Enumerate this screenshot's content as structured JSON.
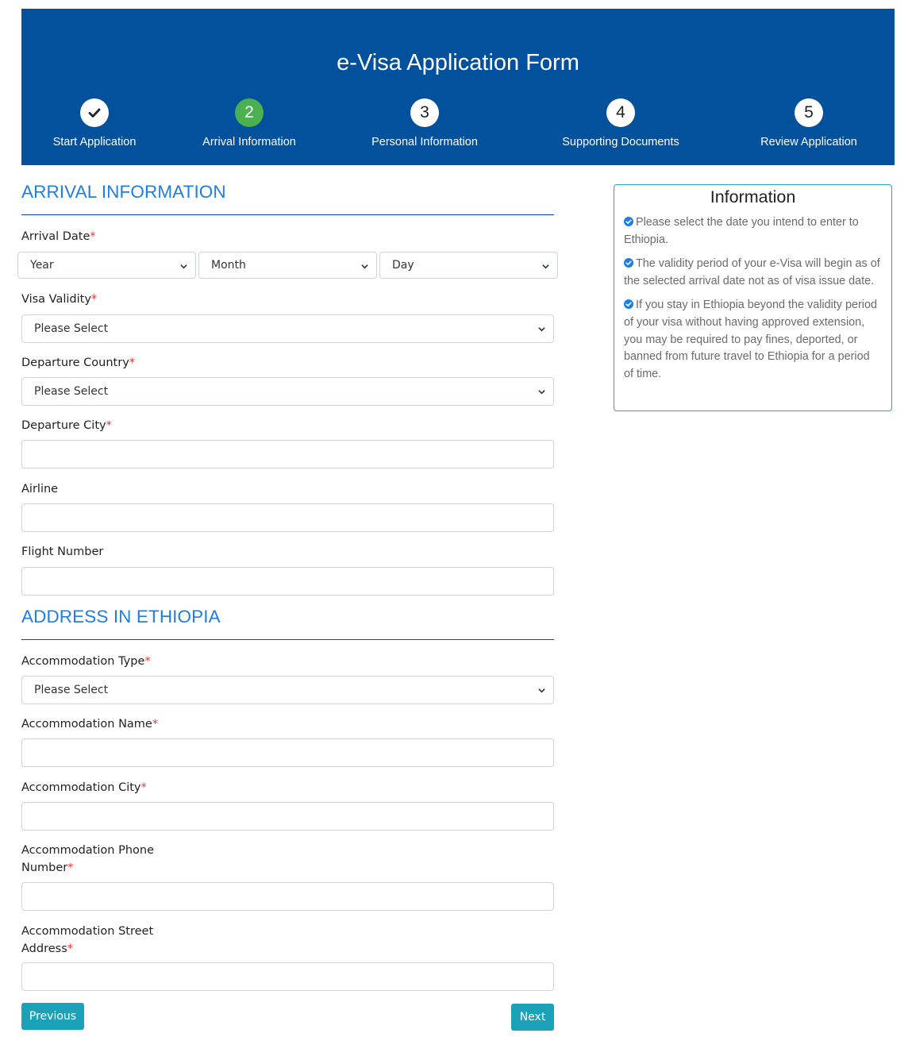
{
  "header": {
    "title": "e-Visa Application Form",
    "steps": [
      {
        "number": "",
        "label": "Start Application",
        "state": "done"
      },
      {
        "number": "2",
        "label": "Arrival Information",
        "state": "active"
      },
      {
        "number": "3",
        "label": "Personal Information",
        "state": "pending"
      },
      {
        "number": "4",
        "label": "Supporting Documents",
        "state": "pending"
      },
      {
        "number": "5",
        "label": "Review Application",
        "state": "pending"
      }
    ]
  },
  "arrival": {
    "section_title": "ARRIVAL INFORMATION",
    "arrival_date_label": "Arrival Date",
    "year": "Year",
    "month": "Month",
    "day": "Day",
    "visa_validity_label": "Visa Validity",
    "visa_validity_value": "Please Select",
    "departure_country_label": "Departure Country",
    "departure_country_value": "Please Select",
    "departure_city_label": "Departure City",
    "departure_city_value": "",
    "airline_label": "Airline",
    "airline_value": "",
    "flight_number_label": "Flight Number",
    "flight_number_value": ""
  },
  "address": {
    "section_title": "ADDRESS IN ETHIOPIA",
    "accommodation_type_label": "Accommodation Type",
    "accommodation_type_value": "Please Select",
    "accommodation_name_label": "Accommodation Name",
    "accommodation_name_value": "",
    "accommodation_city_label": "Accommodation City",
    "accommodation_city_value": "",
    "accommodation_phone_label_1": "Accommodation Phone",
    "accommodation_phone_label_2": "Number",
    "accommodation_phone_value": "",
    "accommodation_street_label_1": "Accommodation Street",
    "accommodation_street_label_2": "Address",
    "accommodation_street_value": ""
  },
  "required_marker": "*",
  "info": {
    "title": "Information",
    "items": [
      "Please select the date you intend to enter to Ethiopia.",
      "The validity period of your e-Visa will begin as of the selected arrival date not as of visa issue date.",
      "If you stay in Ethiopia beyond the validity period of your visa without having approved extension, you may be required to pay fines, deported, or banned from future travel to Ethiopia for a period of time."
    ]
  },
  "buttons": {
    "previous": "Previous",
    "next": "Next"
  },
  "colors": {
    "header_bg": "#03509d",
    "active_step": "#4caf50",
    "section_title": "#1e7fe0",
    "required": "#e53935",
    "button": "#1ba2b8"
  },
  "icons": {
    "done_step": "check-icon",
    "select_arrow": "chevron-down-icon",
    "info_bullet": "check-circle-icon"
  }
}
